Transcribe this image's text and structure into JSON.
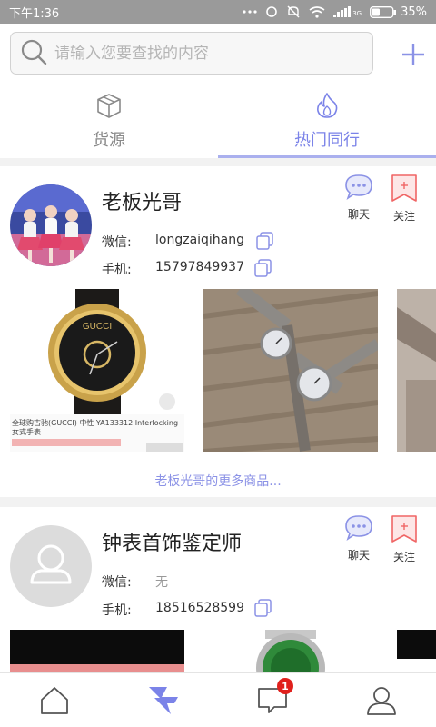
{
  "status_bar": {
    "time": "下午1:36",
    "network": "3G",
    "battery": "35%"
  },
  "search": {
    "placeholder": "请输入您要查找的内容"
  },
  "tabs": [
    {
      "label": "货源",
      "icon": "box-icon",
      "active": false
    },
    {
      "label": "热门同行",
      "icon": "flame-icon",
      "active": true
    }
  ],
  "sellers": [
    {
      "name": "老板光哥",
      "wechat_label": "微信:",
      "wechat": "longzaiqihang",
      "phone_label": "手机:",
      "phone": "15797849937",
      "chat_label": "聊天",
      "follow_label": "关注",
      "products": [
        {
          "caption": "全球购古驰(GUCCI) 中性 YA133312 Interlocking 女式手表",
          "brand": "GUCCI"
        },
        {
          "caption": ""
        },
        {
          "caption": ""
        }
      ],
      "more_label": "老板光哥的更多商品..."
    },
    {
      "name": "钟表首饰鉴定师",
      "wechat_label": "微信:",
      "wechat": "无",
      "phone_label": "手机:",
      "phone": "18516528599",
      "chat_label": "聊天",
      "follow_label": "关注"
    }
  ],
  "bottom_nav": [
    {
      "icon": "home-icon"
    },
    {
      "icon": "lightning-icon",
      "active": true
    },
    {
      "icon": "message-icon",
      "badge": "1"
    },
    {
      "icon": "profile-icon"
    }
  ],
  "colors": {
    "accent": "#7b83e8",
    "follow": "#f06565",
    "badge": "#e0201c"
  }
}
